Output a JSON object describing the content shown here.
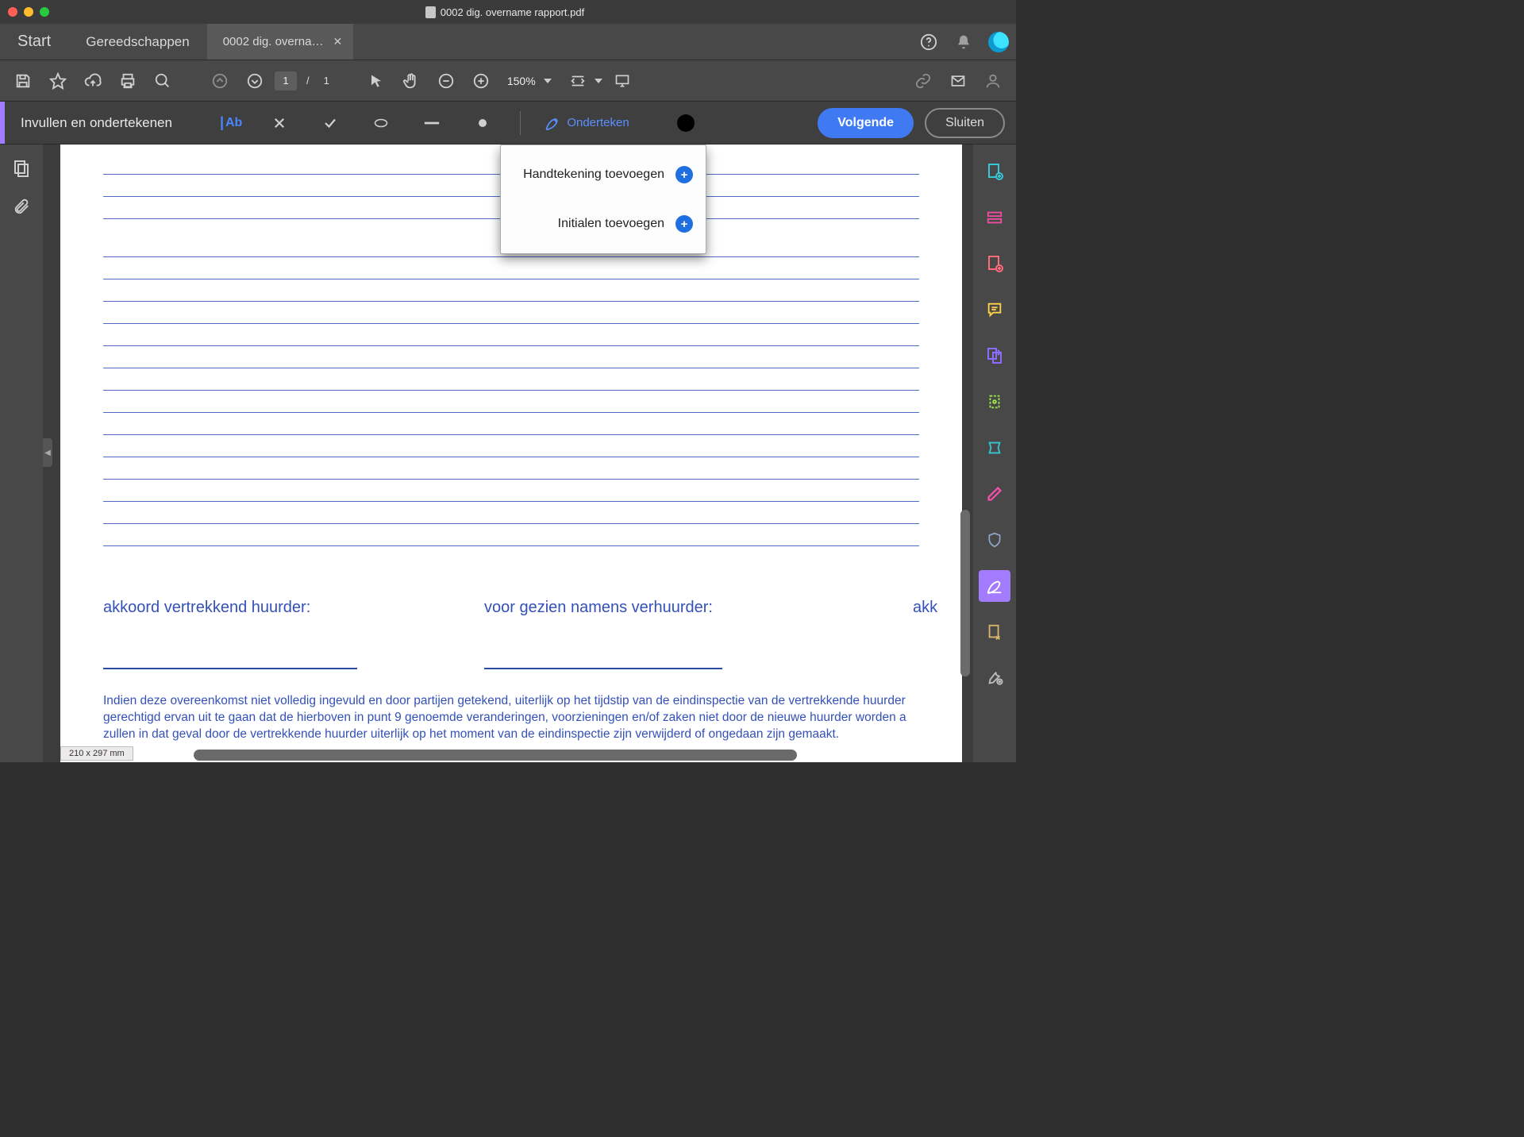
{
  "window": {
    "title": "0002 dig. overname rapport.pdf"
  },
  "tabs": {
    "start": "Start",
    "tools": "Gereedschappen",
    "doc": "0002 dig. overna…"
  },
  "toolbar": {
    "page_current": "1",
    "page_sep": "/",
    "page_total": "1",
    "zoom": "150%"
  },
  "signbar": {
    "title": "Invullen en ondertekenen",
    "text_tool": "Ab",
    "sign_link": "Onderteken",
    "next": "Volgende",
    "close": "Sluiten"
  },
  "dropdown": {
    "add_signature": "Handtekening toevoegen",
    "add_initials": "Initialen toevoegen"
  },
  "document": {
    "sig_left": "akkoord vertrekkend huurder:",
    "sig_mid": "voor gezien namens verhuurder:",
    "sig_right": "akk",
    "fine1": "Indien deze overeenkomst niet volledig ingevuld en door partijen getekend, uiterlijk op het tijdstip van de eindinspectie van de vertrekkende huurder",
    "fine2": "gerechtigd ervan uit te gaan dat de hierboven in punt 9 genoemde veranderingen, voorzieningen en/of zaken niet door de nieuwe huurder worden a",
    "fine3": "zullen in dat geval door de vertrekkende huurder uiterlijk op het moment van de eindinspectie zijn verwijderd of ongedaan zijn gemaakt."
  },
  "status": {
    "page_size": "210 x 297 mm"
  },
  "colors": {
    "accent": "#a27bff",
    "link": "#5b90ff",
    "primary": "#3f7af2"
  }
}
